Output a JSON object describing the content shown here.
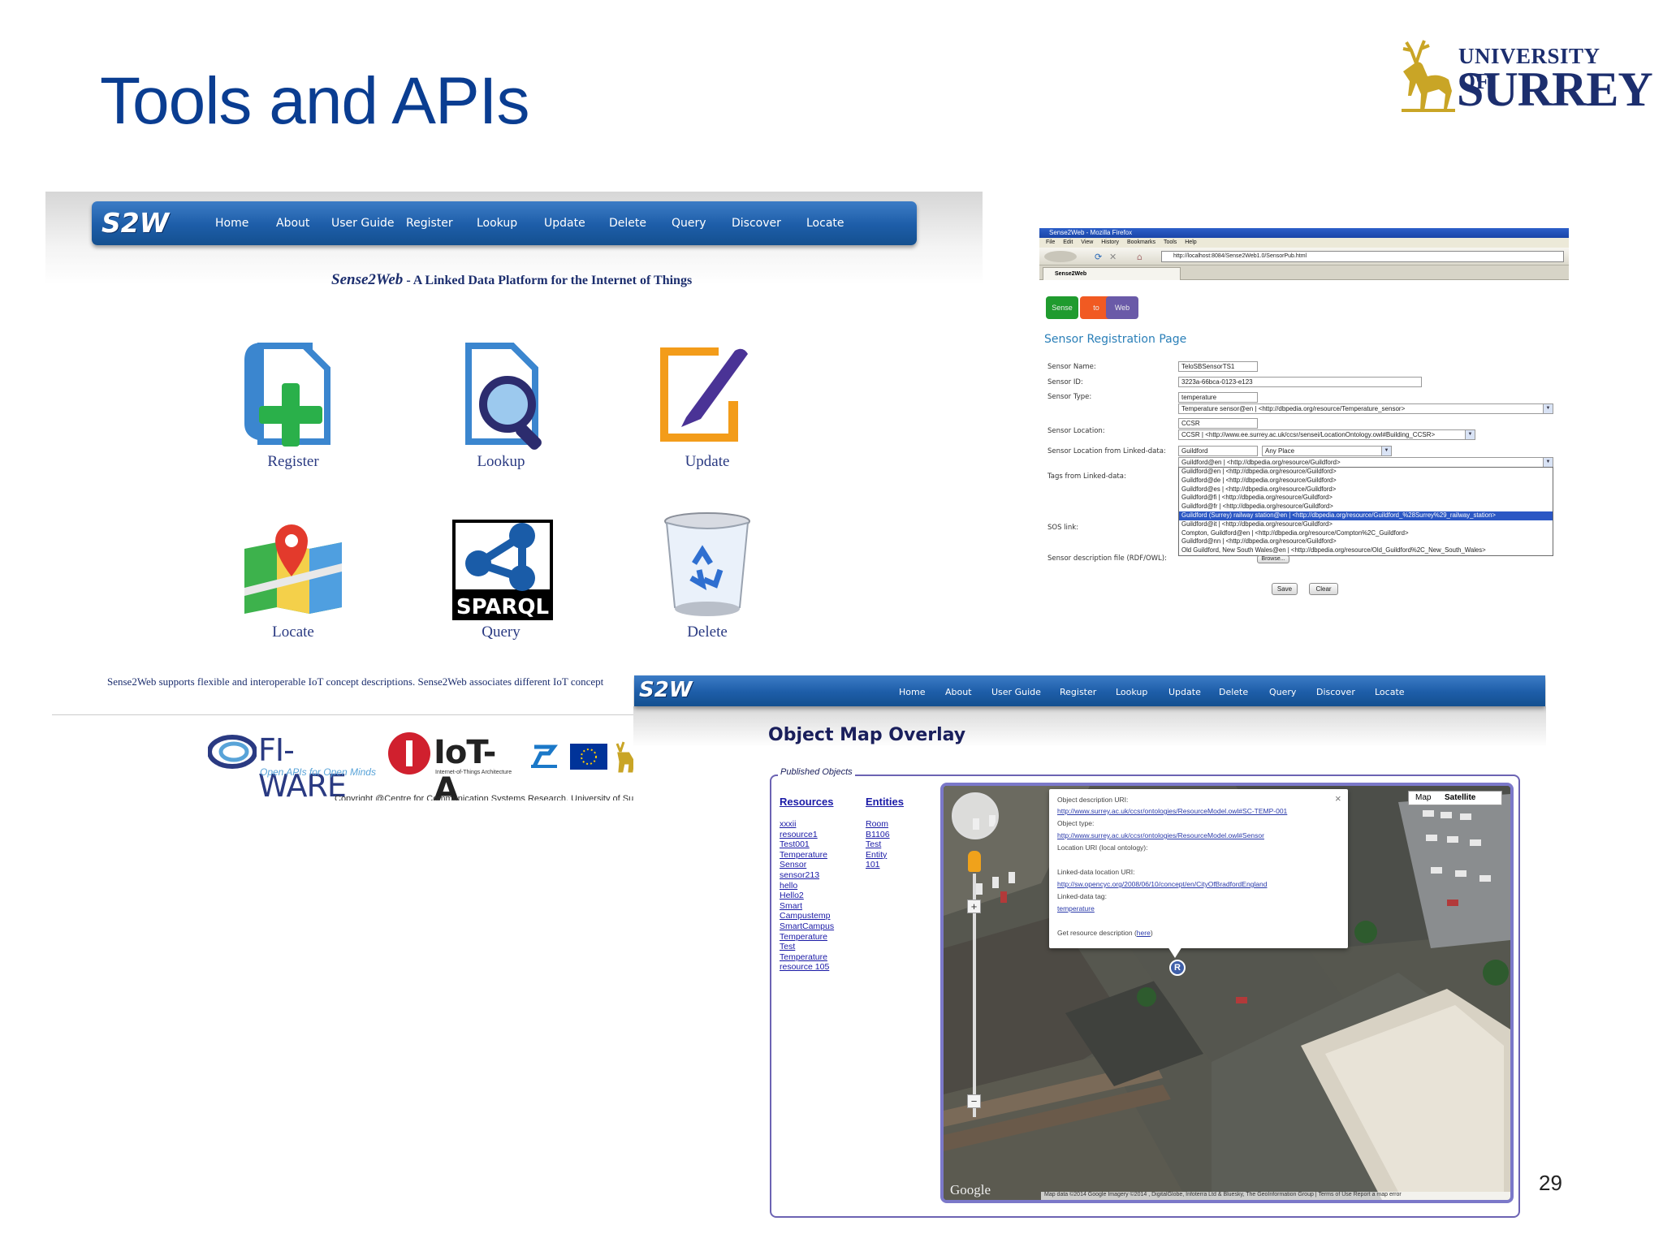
{
  "slide": {
    "title": "Tools and APIs",
    "logo": {
      "line1": "UNIVERSITY OF",
      "line2": "SURREY"
    },
    "page_number": "29"
  },
  "home_screenshot": {
    "brand": "S2W",
    "nav": [
      "Home",
      "About",
      "User Guide",
      "Register",
      "Lookup",
      "Update",
      "Delete",
      "Query",
      "Discover",
      "Locate"
    ],
    "tagline_name": "Sense2Web",
    "tagline_rest": " - A Linked Data Platform for the Internet of Things",
    "tiles": [
      {
        "label": "Register",
        "icon": "register-document-plus-icon"
      },
      {
        "label": "Lookup",
        "icon": "lookup-magnifier-icon"
      },
      {
        "label": "Update",
        "icon": "update-pen-icon"
      },
      {
        "label": "Locate",
        "icon": "locate-map-pin-icon"
      },
      {
        "label": "Query",
        "icon": "sparql-icon",
        "icon_text": "SPARQL"
      },
      {
        "label": "Delete",
        "icon": "recycle-bin-icon"
      }
    ],
    "description": "Sense2Web supports flexible and interoperable IoT concept descriptions. Sense2Web associates different IoT concept",
    "partners": {
      "fiware": "FI-WARE",
      "fiware_sub": "Open APIs for Open Minds",
      "iota": "IoT-A",
      "iota_sub": "Internet-of-Things Architecture"
    },
    "copyright": "Copyright @Centre for Communication Systems Research, University of Sur"
  },
  "registration_screenshot": {
    "window_title": "Sense2Web - Mozilla Firefox",
    "menu": [
      "File",
      "Edit",
      "View",
      "History",
      "Bookmarks",
      "Tools",
      "Help"
    ],
    "url": "http://localhost:8084/Sense2Web1.0/SensorPub.html",
    "tab": "Sense2Web",
    "logo_buttons": [
      {
        "label": "Sense",
        "color": "#1f9b2e"
      },
      {
        "label": "to",
        "color": "#f15a22"
      },
      {
        "label": "Web",
        "color": "#6a5aa8"
      }
    ],
    "page_title": "Sensor Registration Page",
    "fields": {
      "sensor_name_label": "Sensor Name:",
      "sensor_name": "TeloSBSensorTS1",
      "sensor_id_label": "Sensor ID:",
      "sensor_id": "3223a-66bca-0123-e123",
      "sensor_type_label": "Sensor Type:",
      "sensor_type": "temperature",
      "sensor_type_select": "Temperature sensor@en | <http://dbpedia.org/resource/Temperature_sensor>",
      "sensor_location_label": "Sensor Location:",
      "sensor_location": "CCSR",
      "sensor_location_select": "CCSR | <http://www.ee.surrey.ac.uk/ccsr/sensei/LocationOntology.owl#Building_CCSR>",
      "linked_location_label": "Sensor Location from Linked-data:",
      "linked_location": "Guildford",
      "linked_place": "Any Place",
      "tags_label": "Tags from Linked-data:",
      "tags_select": "Guildford@en | <http://dbpedia.org/resource/Guildford>",
      "sos_label": "SOS link:",
      "rdf_label": "Sensor description  file (RDF/OWL):",
      "browse": "Browse..."
    },
    "dropdown_options": [
      "Guildford@en | <http://dbpedia.org/resource/Guildford>",
      "Guildford@de | <http://dbpedia.org/resource/Guildford>",
      "Guildford@es | <http://dbpedia.org/resource/Guildford>",
      "Guildford@fi | <http://dbpedia.org/resource/Guildford>",
      "Guildford@fr | <http://dbpedia.org/resource/Guildford>",
      "Guildford (Surrey) railway station@en | <http://dbpedia.org/resource/Guildford_%28Surrey%29_railway_station>",
      "Guildford@it | <http://dbpedia.org/resource/Guildford>",
      "Compton, Guildford@en | <http://dbpedia.org/resource/Compton%2C_Guildford>",
      "Guildford@nn | <http://dbpedia.org/resource/Guildford>",
      "Old Guildford, New South Wales@en | <http://dbpedia.org/resource/Old_Guildford%2C_New_South_Wales>"
    ],
    "selected_option_index": 5,
    "save": "Save",
    "clear": "Clear"
  },
  "map_screenshot": {
    "brand": "S2W",
    "nav": [
      "Home",
      "About",
      "User Guide",
      "Register",
      "Lookup",
      "Update",
      "Delete",
      "Query",
      "Discover",
      "Locate"
    ],
    "title": "Object Map Overlay",
    "legend": "Published Objects",
    "resources_heading": "Resources",
    "resources": [
      "xxxii",
      "resource1",
      "Test001",
      "Temperature",
      "Sensor",
      "sensor213",
      "hello",
      "Hello2",
      "Smart",
      "Campustemp",
      "SmartCampus",
      "Temperature",
      "Test",
      "Temperature",
      "resource 105"
    ],
    "entities_heading": "Entities",
    "entities": [
      "Room",
      "B1106",
      "Test",
      "Entity",
      "101"
    ],
    "map_type": {
      "map": "Map",
      "satellite": "Satellite"
    },
    "info": {
      "desc_uri_label": "Object description URI:",
      "desc_uri": "http://www.surrey.ac.uk/ccsr/ontologies/ResourceModel.owl#SC-TEMP-001",
      "type_label": "Object type:",
      "type": "http://www.surrey.ac.uk/ccsr/ontologies/ResourceModel.owl#Sensor",
      "location_label": "Location URI (local ontology):",
      "linked_location_label": "Linked-data location URI:",
      "linked_location": "http://sw.opencyc.org/2008/06/10/concept/en/CityOfBradfordEngland",
      "tag_label": "Linked-data tag:",
      "tag": "temperature",
      "get_desc": "Get resource description (",
      "here": "here",
      "get_desc_end": ")"
    },
    "marker_label": "R",
    "google": "Google",
    "attribution": "Map data ©2014 Google Imagery ©2014 , DigitalGlobe, Infoterra Ltd & Bluesky, The GeoInformation Group | Terms of Use   Report a map error"
  }
}
